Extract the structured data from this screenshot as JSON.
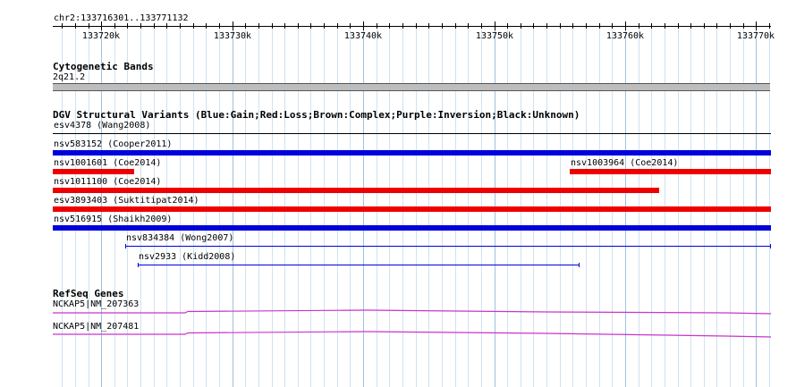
{
  "location": "chr2:133716301..133771132",
  "ruler": {
    "start": 133716301,
    "end": 133771132,
    "ticks": [
      {
        "pos": 133720000,
        "label": "133720k"
      },
      {
        "pos": 133730000,
        "label": "133730k"
      },
      {
        "pos": 133740000,
        "label": "133740k"
      },
      {
        "pos": 133750000,
        "label": "133750k"
      },
      {
        "pos": 133760000,
        "label": "133760k"
      },
      {
        "pos": 133770000,
        "label": "133770k"
      }
    ]
  },
  "tracks": {
    "cytoband": {
      "title": "Cytogenetic Bands",
      "band_label": "2q21.2"
    },
    "dgv": {
      "title": "DGV Structural Variants (Blue:Gain;Red:Loss;Brown:Complex;Purple:Inversion;Black:Unknown)",
      "colors": {
        "gain": "#0000dd",
        "loss": "#ee0000",
        "unknown": "#000000"
      },
      "features": [
        {
          "label": "esv4378 (Wang2008)",
          "type": "unknown",
          "start": 133716301,
          "end": 133771132,
          "style": "thin"
        },
        {
          "label": "nsv583152 (Cooper2011)",
          "type": "gain",
          "start": 133716301,
          "end": 133771132,
          "style": "thick"
        },
        {
          "label": "nsv1001601 (Coe2014)",
          "type": "loss",
          "start": 133716301,
          "end": 133722500,
          "style": "thick"
        },
        {
          "label": "nsv1003964 (Coe2014)",
          "type": "loss",
          "start": 133755800,
          "end": 133771132,
          "style": "thick"
        },
        {
          "label": "nsv1011100 (Coe2014)",
          "type": "loss",
          "start": 133716301,
          "end": 133762600,
          "style": "thick"
        },
        {
          "label": "esv3893403 (Suktitipat2014)",
          "type": "loss",
          "start": 133716301,
          "end": 133771132,
          "style": "thick"
        },
        {
          "label": "nsv516915 (Shaikh2009)",
          "type": "gain",
          "start": 133716301,
          "end": 133771132,
          "style": "thick"
        },
        {
          "label": "nsv834384 (Wong2007)",
          "type": "gain",
          "start": 133721800,
          "end": 133771132,
          "style": "thin"
        },
        {
          "label": "nsv2933 (Kidd2008)",
          "type": "gain",
          "start": 133722800,
          "end": 133756500,
          "style": "thin"
        }
      ]
    },
    "refseq": {
      "title": "RefSeq Genes",
      "color": "#cc33cc",
      "genes": [
        {
          "label": "NCKAP5|NM_207363"
        },
        {
          "label": "NCKAP5|NM_207481"
        }
      ]
    }
  }
}
